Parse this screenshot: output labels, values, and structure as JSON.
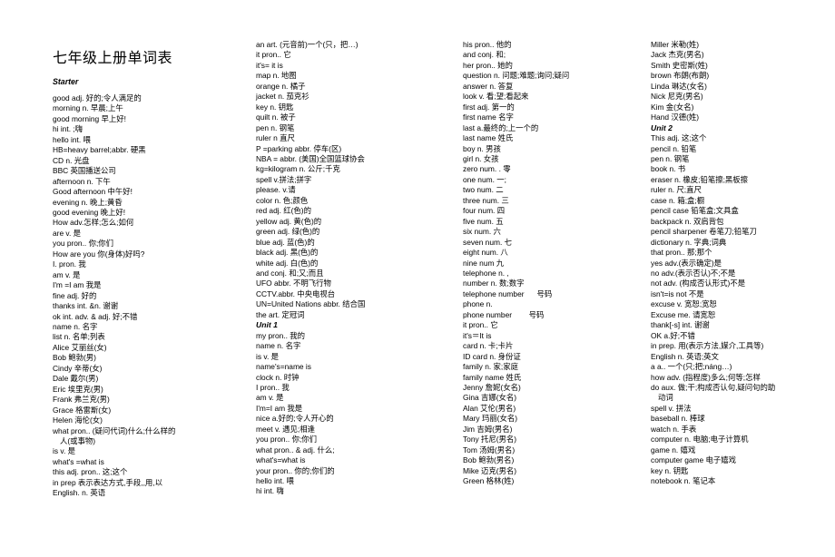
{
  "document": {
    "title": "七年级上册单词表",
    "starter_heading": "Starter",
    "unit1_heading": "Unit 1",
    "unit2_heading": "Unit 2"
  },
  "columns": [
    {
      "id": "column-1",
      "entries": [
        {
          "type": "heading",
          "text": "Starter"
        },
        {
          "type": "entry",
          "text": "good adj. 好的;令人满足的"
        },
        {
          "type": "entry",
          "text": "morning n. 早晨;上午"
        },
        {
          "type": "entry",
          "text": "good morning 早上好!"
        },
        {
          "type": "entry",
          "text": "hi int. ;嗨"
        },
        {
          "type": "entry",
          "text": "hello int. 喂"
        },
        {
          "type": "entry",
          "text": "HB=heavy barrel;abbr. 硬黑"
        },
        {
          "type": "entry",
          "text": "CD n. 光盘"
        },
        {
          "type": "entry",
          "text": "BBC 英国播送公司"
        },
        {
          "type": "entry",
          "text": "afternoon n. 下午"
        },
        {
          "type": "entry",
          "text": "Good afternoon 中午好!"
        },
        {
          "type": "entry",
          "text": "evening n. 晚上;黄昏"
        },
        {
          "type": "entry",
          "text": "good evening 晚上好!"
        },
        {
          "type": "entry",
          "text": "How adv.怎样;怎么;如何"
        },
        {
          "type": "entry",
          "text": "are v. 是"
        },
        {
          "type": "entry",
          "text": "you pron.. 你;你们"
        },
        {
          "type": "entry",
          "text": "How are you 你(身体)好吗?"
        },
        {
          "type": "entry",
          "text": "I. pron. 我"
        },
        {
          "type": "entry",
          "text": "am v. 是"
        },
        {
          "type": "entry",
          "text": "I'm =I am 我是"
        },
        {
          "type": "entry",
          "text": "fine adj. 好的"
        },
        {
          "type": "entry",
          "text": "thanks int. &n. 谢谢"
        },
        {
          "type": "entry",
          "text": "ok int. adv. & adj. 好;不错"
        },
        {
          "type": "entry",
          "text": "name n. 名字"
        },
        {
          "type": "entry",
          "text": "list n. 名单;列表"
        },
        {
          "type": "entry",
          "text": "Alice 艾丽丝(女)"
        },
        {
          "type": "entry",
          "text": "Bob 鲍勃(男)"
        },
        {
          "type": "entry",
          "text": "Cindy 辛蒂(女)"
        },
        {
          "type": "entry",
          "text": "Dale 戴尔(男)"
        },
        {
          "type": "entry",
          "text": "Eric 埃里克(男)"
        },
        {
          "type": "entry",
          "text": "Frank 弗兰克(男)"
        },
        {
          "type": "entry",
          "text": "Grace 格雷斯(女)"
        },
        {
          "type": "entry",
          "text": "Helen 海伦(女)"
        },
        {
          "type": "entry",
          "text": "what pron.. (疑问代词)什么;什么样的"
        },
        {
          "type": "cont",
          "text": "人(或事物)"
        },
        {
          "type": "entry",
          "text": "is v. 是"
        },
        {
          "type": "entry",
          "text": "what's =what is"
        },
        {
          "type": "entry",
          "text": "this adj. pron.. 这;这个"
        },
        {
          "type": "entry",
          "text": "in prep 表示表达方式,手段,,用,以"
        },
        {
          "type": "entry",
          "text": "English. n. 英语"
        }
      ]
    },
    {
      "id": "column-2",
      "entries": [
        {
          "type": "entry",
          "text": "an art. (元音前)一个(只，把…)"
        },
        {
          "type": "entry",
          "text": "it pron.. 它"
        },
        {
          "type": "entry",
          "text": "it's= it is"
        },
        {
          "type": "entry",
          "text": "map n. 地图"
        },
        {
          "type": "entry",
          "text": "orange n. 橘子"
        },
        {
          "type": "entry",
          "text": "jacket n. 茄克衫"
        },
        {
          "type": "entry",
          "text": "key n. 钥匙"
        },
        {
          "type": "entry",
          "text": "quilt n. 被子"
        },
        {
          "type": "entry",
          "text": "pen n. 钢笔"
        },
        {
          "type": "entry",
          "text": "ruler n 直尺"
        },
        {
          "type": "entry",
          "text": "P =parking abbr. 停车(区)"
        },
        {
          "type": "entry",
          "text": "NBA = abbr. (美国)全国篮球协会"
        },
        {
          "type": "entry",
          "text": "kg=kilogram n. 公斤;千克"
        },
        {
          "type": "entry",
          "text": "spell v.拼法;拼字"
        },
        {
          "type": "entry",
          "text": "please. v.请"
        },
        {
          "type": "entry",
          "text": "color n. 色;颜色"
        },
        {
          "type": "entry",
          "text": "red adj. 红(色)的"
        },
        {
          "type": "entry",
          "text": "yellow adj. 黄(色)的"
        },
        {
          "type": "entry",
          "text": "green adj. 绿(色)的"
        },
        {
          "type": "entry",
          "text": "blue adj. 蓝(色)的"
        },
        {
          "type": "entry",
          "text": "black adj. 黑(色)的"
        },
        {
          "type": "entry",
          "text": "white adj. 白(色)的"
        },
        {
          "type": "entry",
          "text": "and conj. 和;又;而且"
        },
        {
          "type": "entry",
          "text": "UFO abbr. 不明飞行物"
        },
        {
          "type": "entry",
          "text": "CCTV.abbr. 中央电视台"
        },
        {
          "type": "entry",
          "text": "UN=United Nations abbr. 结合国"
        },
        {
          "type": "entry",
          "text": "the art. 定冠词"
        },
        {
          "type": "heading",
          "text": "Unit 1"
        },
        {
          "type": "entry",
          "text": "my pron.. 我的"
        },
        {
          "type": "entry",
          "text": "name n. 名字"
        },
        {
          "type": "entry",
          "text": "is v. 是"
        },
        {
          "type": "entry",
          "text": "name's=name is"
        },
        {
          "type": "entry",
          "text": "clock n. 时钟"
        },
        {
          "type": "entry",
          "text": "I pron.. 我"
        },
        {
          "type": "entry",
          "text": "am v. 是"
        },
        {
          "type": "entry",
          "text": "I'm=I am 我是"
        },
        {
          "type": "entry",
          "text": "nice a.好的;令人开心的"
        },
        {
          "type": "entry",
          "text": "meet v. 遇见;相逢"
        },
        {
          "type": "entry",
          "text": "you pron.. 你;你们"
        },
        {
          "type": "entry",
          "text": "what pron.. & adj. 什么;"
        },
        {
          "type": "entry",
          "text": "what's=what is"
        },
        {
          "type": "entry",
          "text": "your pron.. 你的;你们的"
        },
        {
          "type": "entry",
          "text": "hello int. 喂"
        },
        {
          "type": "entry",
          "text": "hi int. 嗨"
        }
      ]
    },
    {
      "id": "column-3",
      "entries": [
        {
          "type": "entry",
          "text": "his pron.. 他的"
        },
        {
          "type": "entry",
          "text": "and conj. 和;"
        },
        {
          "type": "entry",
          "text": "her pron.. 她的"
        },
        {
          "type": "entry",
          "text": "question n. 问题;难题;询问;疑问"
        },
        {
          "type": "entry",
          "text": "answer n. 答复"
        },
        {
          "type": "entry",
          "text": "look v. 看;望;看起来"
        },
        {
          "type": "entry",
          "text": "first adj. 第一的"
        },
        {
          "type": "entry",
          "text": "first name 名字"
        },
        {
          "type": "entry",
          "text": "last a.最终的;上一个的"
        },
        {
          "type": "entry",
          "text": "last name 姓氏"
        },
        {
          "type": "entry",
          "text": "boy n. 男孩"
        },
        {
          "type": "entry",
          "text": "girl n. 女孩"
        },
        {
          "type": "entry",
          "text": "zero num. . 零"
        },
        {
          "type": "entry",
          "text": "one num. 一;"
        },
        {
          "type": "entry",
          "text": "two num. 二"
        },
        {
          "type": "entry",
          "text": "three num. 三"
        },
        {
          "type": "entry",
          "text": "four num. 四"
        },
        {
          "type": "entry",
          "text": "five num. 五"
        },
        {
          "type": "entry",
          "text": "six num. 六"
        },
        {
          "type": "entry",
          "text": "seven num. 七"
        },
        {
          "type": "entry",
          "text": "eight num. 八"
        },
        {
          "type": "entry",
          "text": "nine num 九"
        },
        {
          "type": "entry",
          "text": "telephone n. ,"
        },
        {
          "type": "entry",
          "text": "number n. 数;数字"
        },
        {
          "type": "entry",
          "text": "telephone number      号码"
        },
        {
          "type": "entry",
          "text": "phone n."
        },
        {
          "type": "entry",
          "text": "phone number        号码"
        },
        {
          "type": "entry",
          "text": "it pron.. 它"
        },
        {
          "type": "entry",
          "text": "it's＝It is"
        },
        {
          "type": "entry",
          "text": "card n. 卡;卡片"
        },
        {
          "type": "entry",
          "text": "ID card n. 身份证"
        },
        {
          "type": "entry",
          "text": "family n. 家;家庭"
        },
        {
          "type": "entry",
          "text": "family name 姓氏"
        },
        {
          "type": "entry",
          "text": "Jenny 詹妮(女名)"
        },
        {
          "type": "entry",
          "text": "Gina 吉娜(女名)"
        },
        {
          "type": "entry",
          "text": "Alan 艾伦(男名)"
        },
        {
          "type": "entry",
          "text": "Mary 玛丽(女名)"
        },
        {
          "type": "entry",
          "text": "Jim 吉姆(男名)"
        },
        {
          "type": "entry",
          "text": "Tony 托尼(男名)"
        },
        {
          "type": "entry",
          "text": "Tom 汤姆(男名)"
        },
        {
          "type": "entry",
          "text": "Bob 鲍勃(男名)"
        },
        {
          "type": "entry",
          "text": "Mike 迈克(男名)"
        },
        {
          "type": "entry",
          "text": "Green 格林(姓)"
        }
      ]
    },
    {
      "id": "column-4",
      "entries": [
        {
          "type": "entry",
          "text": "Miller 米勒(姓)"
        },
        {
          "type": "entry",
          "text": "Jack 杰克(男名)"
        },
        {
          "type": "entry",
          "text": "Smith 史密斯(姓)"
        },
        {
          "type": "entry",
          "text": "brown 布朗(布朗)"
        },
        {
          "type": "entry",
          "text": "Linda 琳达(女名)"
        },
        {
          "type": "entry",
          "text": "Nick 尼克(男名)"
        },
        {
          "type": "entry",
          "text": "Kim 金(女名)"
        },
        {
          "type": "entry",
          "text": "Hand 汉德(姓)"
        },
        {
          "type": "heading",
          "text": "Unit 2"
        },
        {
          "type": "entry",
          "text": "This adj. 这;这个"
        },
        {
          "type": "entry",
          "text": "pencil n. 铅笔"
        },
        {
          "type": "entry",
          "text": "pen n. 钢笔"
        },
        {
          "type": "entry",
          "text": "book n. 书"
        },
        {
          "type": "entry",
          "text": "eraser n. 橡皮;铅笔擦;黑板擦"
        },
        {
          "type": "entry",
          "text": "ruler n. 尺;直尺"
        },
        {
          "type": "entry",
          "text": "case n. 箱;盒;橱"
        },
        {
          "type": "entry",
          "text": "pencil case 铅笔盒;文具盒"
        },
        {
          "type": "entry",
          "text": "backpack n. 双肩背包"
        },
        {
          "type": "entry",
          "text": "pencil sharpener 卷笔刀;铅笔刀"
        },
        {
          "type": "entry",
          "text": "dictionary n. 字典;词典"
        },
        {
          "type": "entry",
          "text": "that pron.. 那;那个"
        },
        {
          "type": "entry",
          "text": "yes adv.(表示确定)是"
        },
        {
          "type": "entry",
          "text": "no adv.(表示否认)不;不是"
        },
        {
          "type": "entry",
          "text": "not adv. (构成否认形式)不是"
        },
        {
          "type": "entry",
          "text": "isn't=is not 不是"
        },
        {
          "type": "entry",
          "text": "excuse v. 宽恕;宽恕"
        },
        {
          "type": "entry",
          "text": "Excuse me. 请宽恕"
        },
        {
          "type": "entry",
          "text": "thank[-s] int. 谢谢"
        },
        {
          "type": "entry",
          "text": "OK a.好;不错"
        },
        {
          "type": "entry",
          "text": "in prep. 用(表示方法,媒介,工具等)"
        },
        {
          "type": "entry",
          "text": "English n. 英语;英文"
        },
        {
          "type": "entry",
          "text": "a a.. 一个(只;把;náng…)"
        },
        {
          "type": "entry",
          "text": "how adv. (指程度)多么;何等;怎样"
        },
        {
          "type": "entry",
          "text": "do aux. 做;干;构成否认句,疑问句的助"
        },
        {
          "type": "cont",
          "text": "动词"
        },
        {
          "type": "entry",
          "text": "spell v. 拼法"
        },
        {
          "type": "entry",
          "text": "baseball n. 棒球"
        },
        {
          "type": "entry",
          "text": "watch n. 手表"
        },
        {
          "type": "entry",
          "text": "computer n. 电脑;电子计算机"
        },
        {
          "type": "entry",
          "text": "game n. 嬉戏"
        },
        {
          "type": "entry",
          "text": "computer game 电子嬉戏"
        },
        {
          "type": "entry",
          "text": "key n. 钥匙"
        },
        {
          "type": "entry",
          "text": "notebook n. 笔记本"
        }
      ]
    }
  ]
}
